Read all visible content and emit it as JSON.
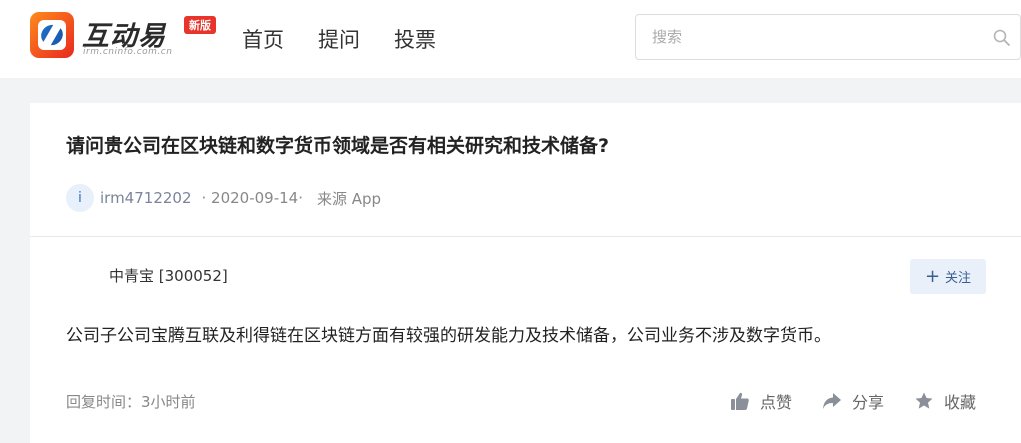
{
  "header": {
    "logo_text": "互动易",
    "logo_sub": "irm.cninfo.com.cn",
    "logo_badge": "新版",
    "nav": [
      {
        "label": "首页"
      },
      {
        "label": "提问"
      },
      {
        "label": "投票"
      }
    ],
    "search": {
      "placeholder": "搜索",
      "icon": "search-icon"
    }
  },
  "question": {
    "title": "请问贵公司在区块链和数字货币领域是否有相关研究和技术储备?",
    "avatar_letter": "i",
    "user": "irm4712202",
    "date": "· 2020-09-14·",
    "source": "来源 App"
  },
  "answer": {
    "company": "中青宝 [300052]",
    "follow_label": "关注",
    "text": "公司子公司宝腾互联及利得链在区块链方面有较强的研发能力及技术储备，公司业务不涉及数字货币。",
    "reply_time": "回复时间：3小时前",
    "actions": {
      "like": "点赞",
      "share": "分享",
      "favorite": "收藏"
    }
  },
  "colors": {
    "brand_orange": "#ff8a1c",
    "brand_red": "#e8281e",
    "link_blue": "#3a5e93",
    "follow_bg": "#e9f0fa"
  }
}
